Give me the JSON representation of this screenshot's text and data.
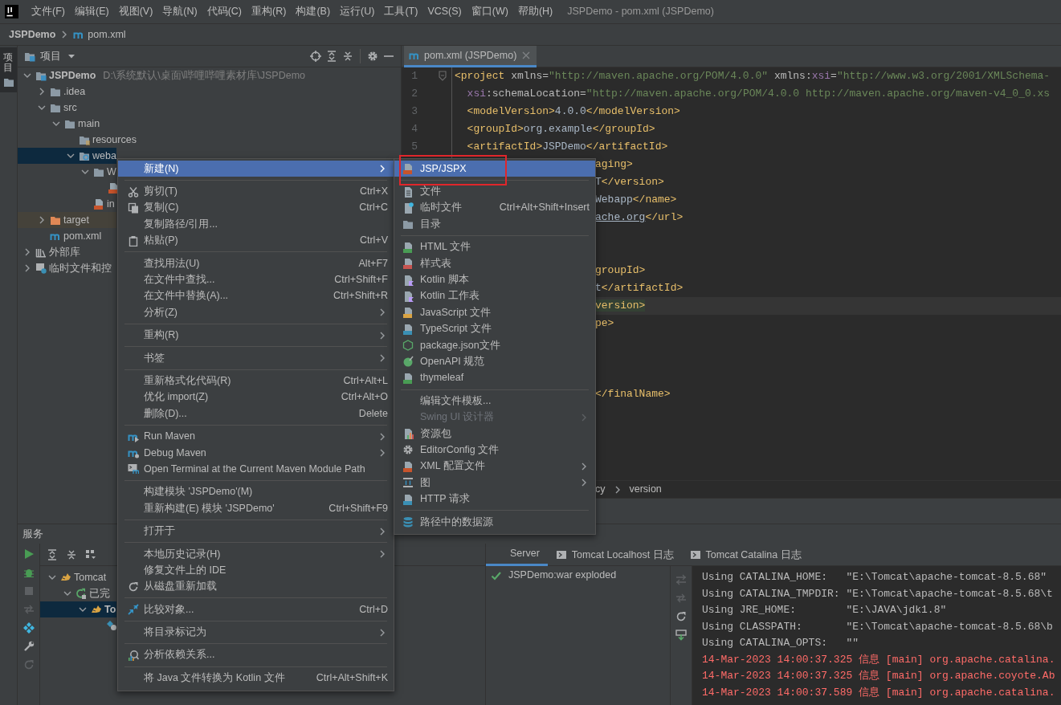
{
  "menubar": {
    "items": [
      "文件(F)",
      "编辑(E)",
      "视图(V)",
      "导航(N)",
      "代码(C)",
      "重构(R)",
      "构建(B)",
      "运行(U)",
      "工具(T)",
      "VCS(S)",
      "窗口(W)",
      "帮助(H)"
    ],
    "title": "JSPDemo - pom.xml (JSPDemo)"
  },
  "navbar": {
    "project": "JSPDemo",
    "file": "pom.xml"
  },
  "tool_strip": {
    "label": "项目",
    "selected": true
  },
  "project_panel": {
    "title": "项目",
    "tree": [
      {
        "label": "JSPDemo",
        "bold": true,
        "detail": "D:\\系统默认\\桌面\\哔哩哔哩素材库\\JSPDemo",
        "kind": "module",
        "expanded": true,
        "selected": false,
        "children": [
          {
            "label": ".idea",
            "kind": "folder",
            "expanded": false,
            "selected": false
          },
          {
            "label": "src",
            "kind": "folder",
            "expanded": true,
            "selected": false,
            "children": [
              {
                "label": "main",
                "kind": "folder",
                "expanded": true,
                "selected": false,
                "children": [
                  {
                    "label": "resources",
                    "kind": "resources",
                    "selected": false
                  },
                  {
                    "label": "weba",
                    "kind": "web",
                    "expanded": true,
                    "selected": true,
                    "children": [
                      {
                        "label": "W",
                        "kind": "folder",
                        "expanded": true,
                        "selected": false,
                        "children": [
                          {
                            "kind": "xml",
                            "selected": false
                          }
                        ]
                      },
                      {
                        "label": "in",
                        "kind": "jsp",
                        "selected": false
                      }
                    ]
                  }
                ]
              }
            ]
          },
          {
            "label": "target",
            "kind": "excluded",
            "excluded": true,
            "expanded": false,
            "selected": false
          },
          {
            "label": "pom.xml",
            "kind": "maven",
            "selected": false
          }
        ]
      },
      {
        "label": "外部库",
        "kind": "library",
        "expanded": false,
        "selected": false
      },
      {
        "label": "临时文件和控",
        "kind": "scratches",
        "expanded": false,
        "selected": false
      }
    ]
  },
  "editor": {
    "tab": {
      "label": "pom.xml (JSPDemo)",
      "selected": true
    },
    "lines": [
      {
        "kind": "full",
        "number": "1",
        "tokens": [
          {
            "kind": "tag",
            "text": "<project"
          },
          {
            "kind": "attr",
            "text": " xmlns="
          },
          {
            "kind": "value",
            "text": "\"http://maven.apache.org/POM/4.0.0\""
          },
          {
            "kind": "attr",
            "text": " xmlns:"
          },
          {
            "kind": "ns",
            "text": "xsi"
          },
          {
            "kind": "attr",
            "text": "="
          },
          {
            "kind": "value",
            "text": "\"http://www.w3.org/2001/XMLSchema-"
          }
        ]
      },
      {
        "kind": "full",
        "number": "2",
        "tokens": [
          {
            "kind": "ns",
            "text": "  xsi"
          },
          {
            "kind": "attr",
            "text": ":schemaLocation="
          },
          {
            "kind": "value",
            "text": "\"http://maven.apache.org/POM/4.0.0 http://maven.apache.org/maven-v4_0_0.xs"
          }
        ]
      },
      {
        "kind": "full",
        "number": "3",
        "tokens": [
          {
            "kind": "tag",
            "text": "  <modelVersion>"
          },
          {
            "kind": "text",
            "text": "4.0.0"
          },
          {
            "kind": "tag",
            "text": "</modelVersion>"
          }
        ]
      },
      {
        "kind": "full",
        "number": "4",
        "tokens": [
          {
            "kind": "tag",
            "text": "  <groupId>"
          },
          {
            "kind": "text",
            "text": "org.example"
          },
          {
            "kind": "tag",
            "text": "</groupId>"
          }
        ]
      },
      {
        "kind": "full",
        "number": "5",
        "tokens": [
          {
            "kind": "tag",
            "text": "  <artifactId>"
          },
          {
            "kind": "text",
            "text": "JSPDemo"
          },
          {
            "kind": "tag",
            "text": "</artifactId>"
          }
        ]
      },
      {
        "kind": "partial",
        "tokens": [
          {
            "kind": "tag",
            "text": "aging>"
          }
        ]
      },
      {
        "kind": "partial",
        "tokens": [
          {
            "kind": "text",
            "text": "T"
          },
          {
            "kind": "tag",
            "text": "</version>"
          }
        ]
      },
      {
        "kind": "partial",
        "tokens": [
          {
            "kind": "text",
            "text": "Webapp"
          },
          {
            "kind": "tag",
            "text": "</name>"
          }
        ]
      },
      {
        "kind": "partial",
        "tokens": [
          {
            "kind": "link",
            "text": "ache.org"
          },
          {
            "kind": "tag",
            "text": "</url>"
          }
        ]
      },
      {
        "kind": "blank"
      },
      {
        "kind": "blank"
      },
      {
        "kind": "partial",
        "tokens": [
          {
            "kind": "tag",
            "text": "groupId>"
          }
        ]
      },
      {
        "kind": "partial",
        "tokens": [
          {
            "kind": "text",
            "text": "t"
          },
          {
            "kind": "tag",
            "text": "</artifactId>"
          }
        ]
      },
      {
        "kind": "partial",
        "current": true,
        "tokens": [
          {
            "kind": "match",
            "text": "version>"
          }
        ]
      },
      {
        "kind": "partial",
        "tokens": [
          {
            "kind": "tag",
            "text": "pe>"
          }
        ]
      },
      {
        "kind": "blank"
      },
      {
        "kind": "blank"
      },
      {
        "kind": "blank"
      },
      {
        "kind": "partial",
        "tokens": [
          {
            "kind": "tag",
            "text": "</finalName>"
          }
        ]
      }
    ],
    "breadcrumb": [
      "cy",
      "version"
    ]
  },
  "services": {
    "title": "服务",
    "tree": [
      {
        "label": "Tomcat",
        "kind": "tomcat",
        "expanded": true,
        "selected": false,
        "children": [
          {
            "label": "已完",
            "kind": "redeploy",
            "expanded": true,
            "selected": false,
            "children": [
              {
                "label": "To",
                "kind": "tomcat",
                "bold": true,
                "expanded": true,
                "selected": true,
                "children": [
                  {
                    "kind": "artifact",
                    "selected": false
                  }
                ]
              }
            ]
          }
        ]
      }
    ],
    "tabs": [
      {
        "label": "Server",
        "kind": "plain",
        "selected": true
      },
      {
        "label": "Tomcat Localhost 日志",
        "kind": "log",
        "selected": false
      },
      {
        "label": "Tomcat Catalina 日志",
        "kind": "log",
        "selected": false
      }
    ],
    "deployments": [
      {
        "label": "JSPDemo:war exploded",
        "kind": "deployed"
      }
    ],
    "console": [
      {
        "kind": "plain",
        "text": "Using CATALINA_HOME:   \"E:\\Tomcat\\apache-tomcat-8.5.68\""
      },
      {
        "kind": "plain",
        "text": "Using CATALINA_TMPDIR: \"E:\\Tomcat\\apache-tomcat-8.5.68\\t"
      },
      {
        "kind": "plain",
        "text": "Using JRE_HOME:        \"E:\\JAVA\\jdk1.8\""
      },
      {
        "kind": "plain",
        "text": "Using CLASSPATH:       \"E:\\Tomcat\\apache-tomcat-8.5.68\\b"
      },
      {
        "kind": "plain",
        "text": "Using CATALINA_OPTS:   \"\""
      },
      {
        "kind": "log",
        "text": "14-Mar-2023 14:00:37.325 信息 [main] org.apache.catalina."
      },
      {
        "kind": "log",
        "text": "14-Mar-2023 14:00:37.325 信息 [main] org.apache.coyote.Ab"
      },
      {
        "kind": "log",
        "text": "14-Mar-2023 14:00:37.589 信息 [main] org.apache.catalina."
      }
    ]
  },
  "context_menu": {
    "items": [
      {
        "kind": "plain",
        "label": "新建(N)",
        "submenu": true,
        "selected": true
      },
      {
        "kind": "separator"
      },
      {
        "kind": "scissors",
        "label": "剪切(T)",
        "shortcut": "Ctrl+X",
        "selected": false
      },
      {
        "kind": "copy",
        "label": "复制(C)",
        "shortcut": "Ctrl+C",
        "selected": false
      },
      {
        "kind": "plain",
        "label": "复制路径/引用...",
        "selected": false
      },
      {
        "kind": "paste",
        "label": "粘贴(P)",
        "shortcut": "Ctrl+V",
        "selected": false
      },
      {
        "kind": "separator"
      },
      {
        "kind": "plain",
        "label": "查找用法(U)",
        "shortcut": "Alt+F7",
        "selected": false
      },
      {
        "kind": "plain",
        "label": "在文件中查找...",
        "shortcut": "Ctrl+Shift+F",
        "selected": false
      },
      {
        "kind": "plain",
        "label": "在文件中替换(A)...",
        "shortcut": "Ctrl+Shift+R",
        "selected": false
      },
      {
        "kind": "plain",
        "label": "分析(Z)",
        "submenu": true,
        "selected": false
      },
      {
        "kind": "separator"
      },
      {
        "kind": "plain",
        "label": "重构(R)",
        "submenu": true,
        "selected": false
      },
      {
        "kind": "separator"
      },
      {
        "kind": "plain",
        "label": "书签",
        "submenu": true,
        "selected": false
      },
      {
        "kind": "separator"
      },
      {
        "kind": "plain",
        "label": "重新格式化代码(R)",
        "shortcut": "Ctrl+Alt+L",
        "selected": false
      },
      {
        "kind": "plain",
        "label": "优化 import(Z)",
        "shortcut": "Ctrl+Alt+O",
        "selected": false
      },
      {
        "kind": "plain",
        "label": "删除(D)...",
        "shortcut": "Delete",
        "selected": false
      },
      {
        "kind": "separator"
      },
      {
        "kind": "mavenrun",
        "label": "Run Maven",
        "submenu": true,
        "selected": false
      },
      {
        "kind": "mavendebug",
        "label": "Debug Maven",
        "submenu": true,
        "selected": false
      },
      {
        "kind": "terminal",
        "label": "Open Terminal at the Current Maven Module Path",
        "selected": false
      },
      {
        "kind": "separator"
      },
      {
        "kind": "plain",
        "label": "构建模块 'JSPDemo'(M)",
        "selected": false
      },
      {
        "kind": "plain",
        "label": "重新构建(E) 模块 'JSPDemo'",
        "shortcut": "Ctrl+Shift+F9",
        "selected": false
      },
      {
        "kind": "separator"
      },
      {
        "kind": "plain",
        "label": "打开于",
        "submenu": true,
        "selected": false
      },
      {
        "kind": "separator"
      },
      {
        "kind": "plain",
        "label": "本地历史记录(H)",
        "submenu": true,
        "selected": false
      },
      {
        "kind": "plain",
        "label": "修复文件上的 IDE",
        "selected": false
      },
      {
        "kind": "reload",
        "label": "从磁盘重新加载",
        "selected": false
      },
      {
        "kind": "separator"
      },
      {
        "kind": "compare",
        "label": "比较对象...",
        "shortcut": "Ctrl+D",
        "selected": false
      },
      {
        "kind": "separator"
      },
      {
        "kind": "plain",
        "label": "将目录标记为",
        "submenu": true,
        "selected": false
      },
      {
        "kind": "separator"
      },
      {
        "kind": "deps",
        "label": "分析依赖关系...",
        "selected": false
      },
      {
        "kind": "separator"
      },
      {
        "kind": "plain",
        "label": "将 Java 文件转换为 Kotlin 文件",
        "shortcut": "Ctrl+Alt+Shift+K",
        "selected": false
      }
    ]
  },
  "submenu": {
    "items": [
      {
        "kind": "jsp",
        "label": "JSP/JSPX",
        "selected": true,
        "disabled": false
      },
      {
        "kind": "separator"
      },
      {
        "kind": "file",
        "label": "文件",
        "selected": false,
        "disabled": false
      },
      {
        "kind": "scratch",
        "label": "临时文件",
        "shortcut": "Ctrl+Alt+Shift+Insert",
        "selected": false,
        "disabled": false
      },
      {
        "kind": "folder",
        "label": "目录",
        "selected": false,
        "disabled": false
      },
      {
        "kind": "separator"
      },
      {
        "kind": "html",
        "label": "HTML 文件",
        "selected": false,
        "disabled": false
      },
      {
        "kind": "css",
        "label": "样式表",
        "selected": false,
        "disabled": false
      },
      {
        "kind": "kotlin",
        "label": "Kotlin 脚本",
        "selected": false,
        "disabled": false
      },
      {
        "kind": "kotlin",
        "label": "Kotlin 工作表",
        "selected": false,
        "disabled": false
      },
      {
        "kind": "js",
        "label": "JavaScript 文件",
        "selected": false,
        "disabled": false
      },
      {
        "kind": "ts",
        "label": "TypeScript 文件",
        "selected": false,
        "disabled": false
      },
      {
        "kind": "nodejs",
        "label": "package.json文件",
        "selected": false,
        "disabled": false
      },
      {
        "kind": "openapi",
        "label": "OpenAPI 规范",
        "selected": false,
        "disabled": false
      },
      {
        "kind": "html",
        "label": "thymeleaf",
        "selected": false,
        "disabled": false
      },
      {
        "kind": "separator"
      },
      {
        "kind": "plain",
        "label": "编辑文件模板...",
        "selected": false,
        "disabled": false
      },
      {
        "kind": "plain",
        "label": "Swing UI 设计器",
        "submenu": true,
        "selected": false,
        "disabled": true
      },
      {
        "kind": "bundle",
        "label": "资源包",
        "selected": false,
        "disabled": false
      },
      {
        "kind": "gear",
        "label": "EditorConfig 文件",
        "selected": false,
        "disabled": false
      },
      {
        "kind": "xml",
        "label": "XML 配置文件",
        "submenu": true,
        "selected": false,
        "disabled": false
      },
      {
        "kind": "diagram",
        "label": "图",
        "submenu": true,
        "selected": false,
        "disabled": false
      },
      {
        "kind": "api",
        "label": "HTTP 请求",
        "selected": false,
        "disabled": false
      },
      {
        "kind": "separator"
      },
      {
        "kind": "database",
        "label": "路径中的数据源",
        "selected": false,
        "disabled": false
      }
    ]
  }
}
